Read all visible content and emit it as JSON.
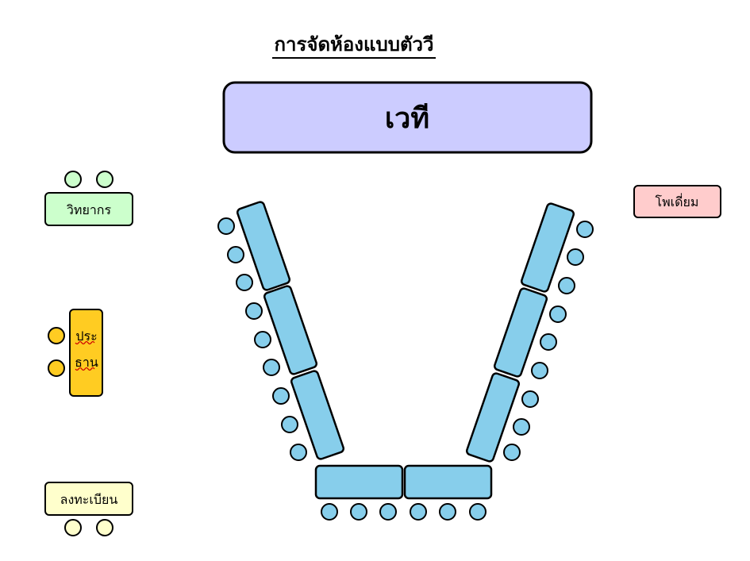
{
  "title": "การจัดห้องแบบตัววี",
  "stage": {
    "label": "เวที",
    "color": "#ccccff"
  },
  "speaker": {
    "label": "วิทยากร",
    "color": "#ccffcc"
  },
  "chairman": {
    "label_line1": "ประ",
    "label_line2": "ธาน",
    "color": "#ffcc22"
  },
  "registration": {
    "label": "ลงทะเบียน",
    "color": "#ffffcc"
  },
  "podium": {
    "label": "โพเดี่ยม",
    "color": "#ffcccc"
  },
  "colors": {
    "table": "#87ceeb",
    "seat": "#87ceeb",
    "outline": "#000000"
  }
}
